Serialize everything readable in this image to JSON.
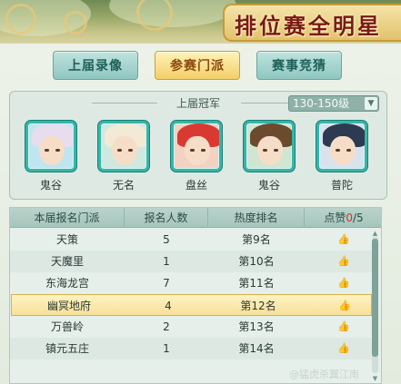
{
  "banner": {
    "title": "排位赛全明星"
  },
  "tabs": [
    {
      "label": "上届录像",
      "active": false
    },
    {
      "label": "参赛门派",
      "active": true
    },
    {
      "label": "赛事竞猜",
      "active": false
    }
  ],
  "champions_panel": {
    "title": "上届冠军",
    "level_select": "130-150级",
    "champions": [
      {
        "name": "鬼谷",
        "hair_color": "#e8dcef"
      },
      {
        "name": "无名",
        "hair_color": "#f3ead6"
      },
      {
        "name": "盘丝",
        "hair_color": "#d83a32"
      },
      {
        "name": "鬼谷",
        "hair_color": "#6b4a2e"
      },
      {
        "name": "普陀",
        "hair_color": "#2d3a52"
      }
    ]
  },
  "table": {
    "headers": {
      "sect": "本届报名门派",
      "count": "报名人数",
      "rank": "热度排名",
      "likes_label": "点赞",
      "likes_used": "0",
      "likes_total": "/5"
    },
    "rows": [
      {
        "sect": "天策",
        "count": "5",
        "rank": "第9名"
      },
      {
        "sect": "天魔里",
        "count": "1",
        "rank": "第10名"
      },
      {
        "sect": "东海龙宫",
        "count": "7",
        "rank": "第11名"
      },
      {
        "sect": "幽冥地府",
        "count": "4",
        "rank": "第12名",
        "highlight": true
      },
      {
        "sect": "万兽岭",
        "count": "2",
        "rank": "第13名"
      },
      {
        "sect": "镇元五庄",
        "count": "1",
        "rank": "第14名"
      }
    ]
  },
  "watermark": "@猛虎杀翼江南"
}
